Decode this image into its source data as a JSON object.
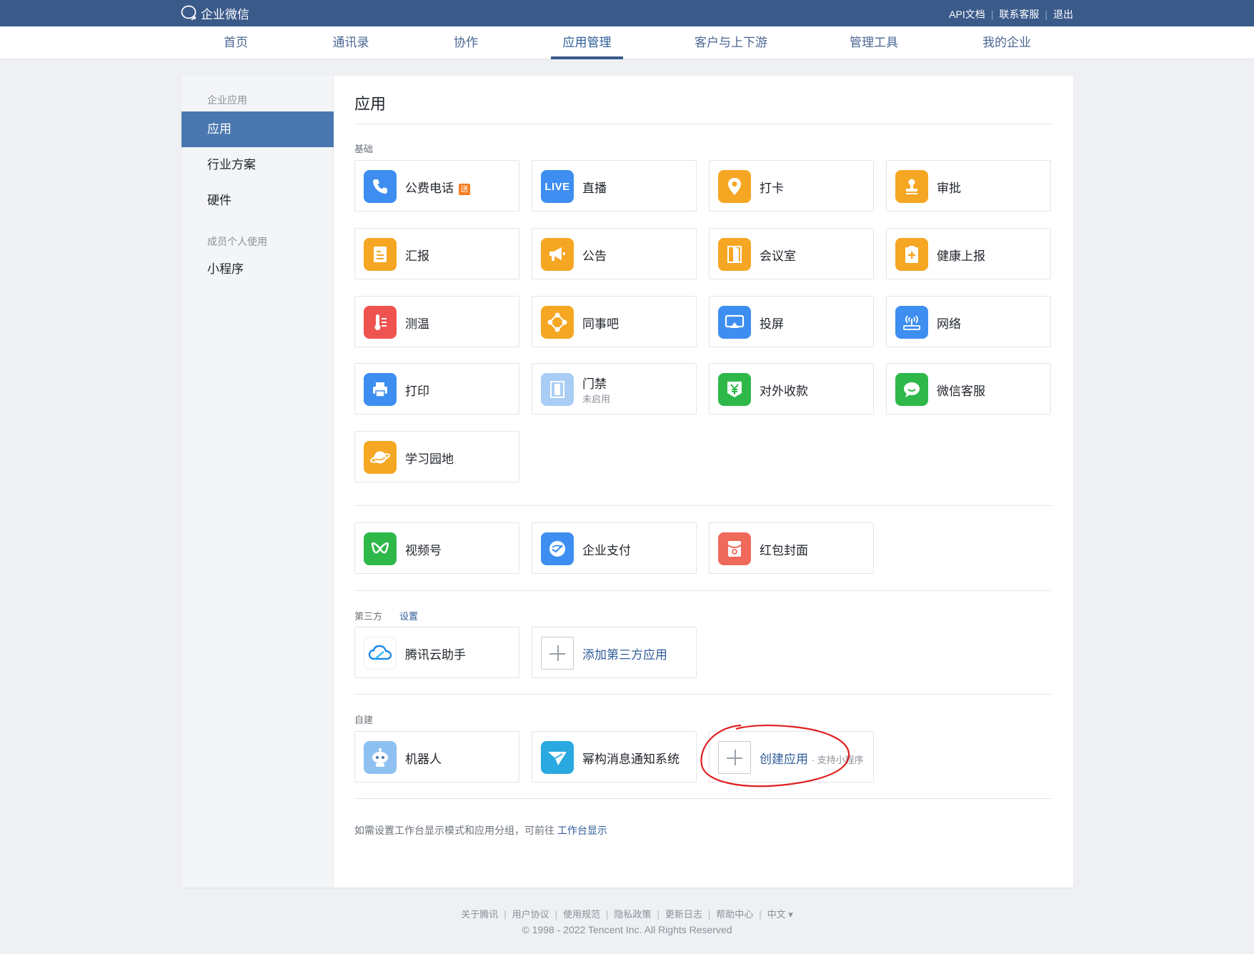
{
  "topbar": {
    "logo_text": "企业微信",
    "links": [
      "API文档",
      "联系客服",
      "退出"
    ]
  },
  "nav": {
    "items": [
      "首页",
      "通讯录",
      "协作",
      "应用管理",
      "客户与上下游",
      "管理工具",
      "我的企业"
    ],
    "active": "应用管理"
  },
  "sidebar": {
    "group1": "企业应用",
    "items1": [
      "应用",
      "行业方案",
      "硬件"
    ],
    "group2": "成员个人使用",
    "items2": [
      "小程序"
    ]
  },
  "content": {
    "title": "应用",
    "basic_label": "基础",
    "basic_apps": [
      {
        "name": "公费电话",
        "badge": "送",
        "icon": "phone-icon",
        "color": "#3d8ef0"
      },
      {
        "name": "直播",
        "icon": "live-icon",
        "color": "#3d8ef0"
      },
      {
        "name": "打卡",
        "icon": "location-pin-icon",
        "color": "#f5a623"
      },
      {
        "name": "审批",
        "icon": "stamp-icon",
        "color": "#f5a623"
      },
      {
        "name": "汇报",
        "icon": "report-icon",
        "color": "#f5a623"
      },
      {
        "name": "公告",
        "icon": "megaphone-icon",
        "color": "#f5a623"
      },
      {
        "name": "会议室",
        "icon": "door-icon",
        "color": "#f5a623"
      },
      {
        "name": "健康上报",
        "icon": "health-report-icon",
        "color": "#f5a623"
      },
      {
        "name": "测温",
        "icon": "thermometer-icon",
        "color": "#ef5350"
      },
      {
        "name": "同事吧",
        "icon": "colleague-bar-icon",
        "color": "#f5a623"
      },
      {
        "name": "投屏",
        "icon": "screen-cast-icon",
        "color": "#3d8ef0"
      },
      {
        "name": "网络",
        "icon": "network-router-icon",
        "color": "#3d8ef0"
      },
      {
        "name": "打印",
        "icon": "printer-icon",
        "color": "#3d8ef0"
      },
      {
        "name": "门禁",
        "sub": "未启用",
        "icon": "access-control-icon",
        "color": "#a9cdf5"
      },
      {
        "name": "对外收款",
        "icon": "yuan-payment-icon",
        "color": "#2fb84a"
      },
      {
        "name": "微信客服",
        "icon": "wechat-service-icon",
        "color": "#2fb84a"
      },
      {
        "name": "学习园地",
        "icon": "planet-icon",
        "color": "#f5a623"
      }
    ],
    "wechat_apps": [
      {
        "name": "视频号",
        "icon": "channels-icon",
        "color": "#2fb84a"
      },
      {
        "name": "企业支付",
        "icon": "enterprise-pay-icon",
        "color": "#3d8ef0"
      },
      {
        "name": "红包封面",
        "icon": "red-packet-icon",
        "color": "#ef6a5b"
      }
    ],
    "third_party_label": "第三方",
    "third_party_settings": "设置",
    "third_party_apps": [
      {
        "name": "腾讯云助手",
        "icon": "tencent-cloud-icon",
        "color": "#ffffff"
      }
    ],
    "add_third_party": "添加第三方应用",
    "self_built_label": "自建",
    "self_built_apps": [
      {
        "name": "机器人",
        "icon": "robot-icon",
        "color": "#8fc0f2"
      },
      {
        "name": "幂构消息通知系统",
        "icon": "paper-plane-icon",
        "color": "#2aa8e0"
      }
    ],
    "create_app": "创建应用",
    "create_app_sub": "· 支持小程序",
    "hint_text": "如需设置工作台显示模式和应用分组，可前往",
    "hint_link": "工作台显示"
  },
  "footer": {
    "links": [
      "关于腾讯",
      "用户协议",
      "使用规范",
      "隐私政策",
      "更新日志",
      "帮助中心",
      "中文 ▾"
    ],
    "copyright": "© 1998 - 2022 Tencent Inc. All Rights Reserved"
  }
}
